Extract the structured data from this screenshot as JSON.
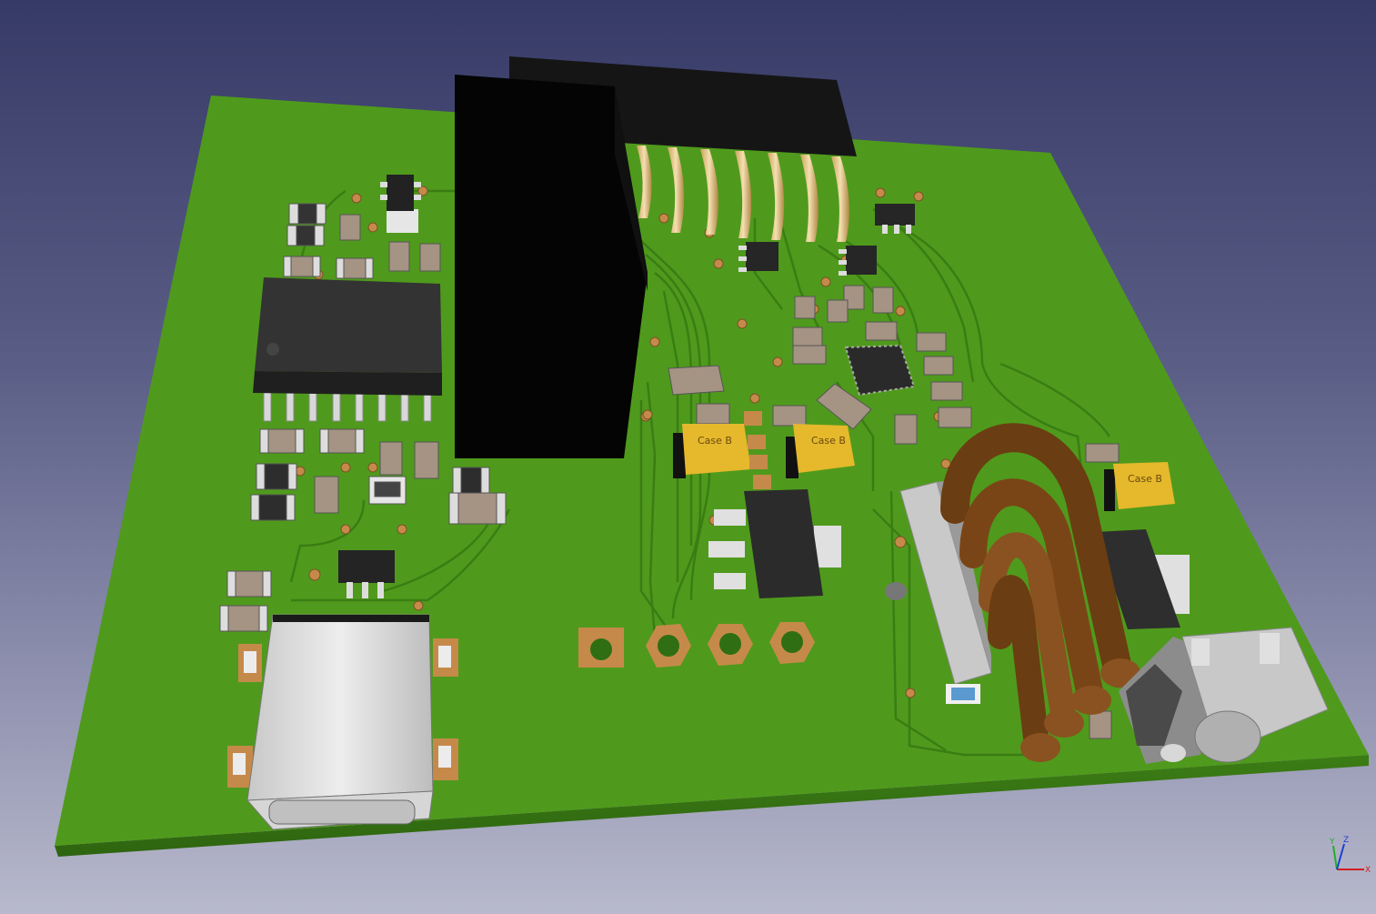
{
  "viewer": {
    "background_top": "#363a66",
    "background_bottom": "#b8b9cc",
    "board_color": "#4f9a1c",
    "trace_color": "#3a7d14",
    "pad_color": "#c58a4a",
    "ic_color": "#2a2a2a",
    "tantalum_color": "#e6b82c"
  },
  "components": {
    "tantalum_labels": [
      "Case B",
      "Case B",
      "Case B"
    ]
  },
  "axes": {
    "x_label": "X",
    "y_label": "Y",
    "z_label": "Z",
    "x_color": "#d21f1f",
    "y_color": "#1fb02a",
    "z_color": "#1f3fd2"
  }
}
